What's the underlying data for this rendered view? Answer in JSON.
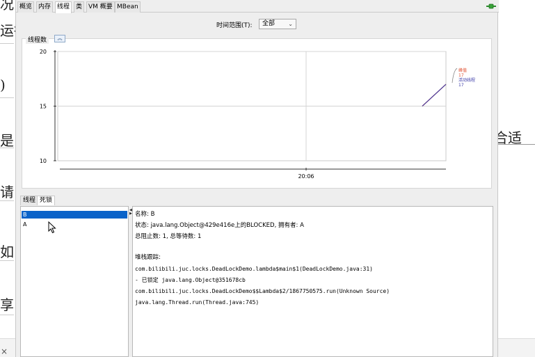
{
  "window": {
    "tabs": [
      "概览",
      "内存",
      "线程",
      "类",
      "VM 概要",
      "MBean"
    ],
    "active_tab": "线程",
    "connection_icon": "plug-connected-icon"
  },
  "range": {
    "label": "时间范围(T):",
    "value": "全部"
  },
  "threads_panel": {
    "title": "线程数",
    "collapse_icon": "double-chevron-up-icon"
  },
  "chart_data": {
    "type": "line",
    "x": [
      "20:06"
    ],
    "ylim": [
      10,
      20
    ],
    "yticks": [
      "20",
      "15",
      "10"
    ],
    "xticks": [
      "20:06"
    ],
    "series": [
      {
        "name": "峰值",
        "color": "#e05030",
        "values": [
          15,
          17
        ],
        "last_label": "17"
      },
      {
        "name": "活动线程",
        "color": "#3a3aa8",
        "values": [
          15,
          17
        ],
        "last_label": "17"
      }
    ],
    "grid": true,
    "legend": "right"
  },
  "subtabs": [
    "线程",
    "死锁"
  ],
  "active_subtab": "死锁",
  "threads_list": [
    "B",
    "A"
  ],
  "selected_thread": "B",
  "detail": {
    "name_line": "名称: B",
    "state_line": "状态: java.lang.Object@429e416e上的BLOCKED, 拥有者: A",
    "counts_line": "总阻止数: 1, 总等待数: 1",
    "stack_header": "堆栈跟踪:",
    "stack": [
      "com.bilibili.juc.locks.DeadLockDemo.lambda$main$1(DeadLockDemo.java:31)",
      "   - 已锁定 java.lang.Object@351678cb",
      "com.bilibili.juc.locks.DeadLockDemo$$Lambda$2/1867750575.run(Unknown Source)",
      "java.lang.Thread.run(Thread.java:745)"
    ]
  },
  "background": {
    "left_chars": [
      "况",
      "运行",
      ")",
      "是",
      "请",
      "如",
      "享"
    ],
    "right_text": "合适",
    "close_glyph": "×"
  }
}
